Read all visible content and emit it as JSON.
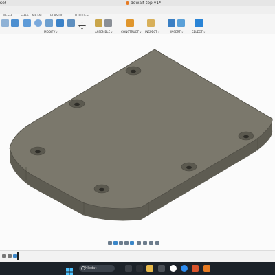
{
  "titlebar": {
    "left_fragment": "se)",
    "document_title": "dewalt top v1*"
  },
  "ribbon": {
    "tabs": [
      "MESH",
      "SHEET METAL",
      "PLASTIC",
      "UTILITIES"
    ],
    "groups": [
      "MODIFY ▾",
      "ASSEMBLE ▾",
      "CONSTRUCT ▾",
      "INSPECT ▾",
      "INSERT ▾",
      "SELECT ▾"
    ]
  },
  "taskbar": {
    "search_placeholder": "Hledat"
  },
  "colors": {
    "plate_top": "#7b786c",
    "plate_side": "#5e5c52",
    "accent_blue": "#2a84d6",
    "taskbar": "#1c2229"
  }
}
